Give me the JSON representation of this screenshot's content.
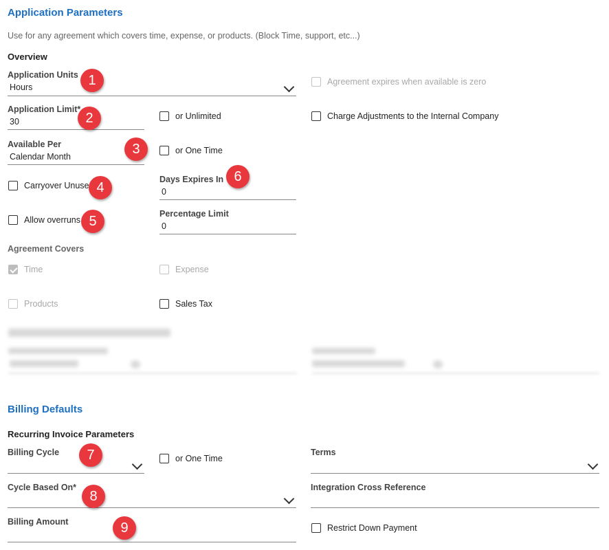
{
  "application_parameters": {
    "title": "Application Parameters",
    "description": "Use for any agreement which covers time, expense, or products. (Block Time, support, etc...)",
    "overview_heading": "Overview",
    "application_units": {
      "label": "Application Units",
      "value": "Hours"
    },
    "agreement_expires_label": "Agreement expires when available is zero",
    "application_limit": {
      "label": "Application Limit*",
      "value": "30"
    },
    "or_unlimited_label": "or Unlimited",
    "charge_adjustments_label": "Charge Adjustments to the Internal Company",
    "available_per": {
      "label": "Available Per",
      "value": "Calendar Month"
    },
    "or_one_time_label": "or One Time",
    "carryover_unused_label": "Carryover Unused",
    "days_expires_in": {
      "label": "Days Expires In",
      "value": "0"
    },
    "allow_overruns_label": "Allow overruns",
    "percentage_limit": {
      "label": "Percentage Limit",
      "value": "0"
    },
    "agreement_covers_heading": "Agreement Covers",
    "covers": {
      "time": "Time",
      "expense": "Expense",
      "products": "Products",
      "sales_tax": "Sales Tax"
    }
  },
  "billing_defaults": {
    "title": "Billing Defaults",
    "recurring_heading": "Recurring Invoice Parameters",
    "billing_cycle_label": "Billing Cycle",
    "or_one_time_label": "or One Time",
    "terms_label": "Terms",
    "cycle_based_on_label": "Cycle Based On*",
    "integration_cross_reference_label": "Integration Cross Reference",
    "billing_amount_label": "Billing Amount",
    "restrict_down_payment_label": "Restrict Down Payment"
  },
  "markers": [
    "1",
    "2",
    "3",
    "4",
    "5",
    "6",
    "7",
    "8",
    "9"
  ],
  "colors": {
    "accent": "#1e6fc0",
    "marker": "#e8383d"
  }
}
